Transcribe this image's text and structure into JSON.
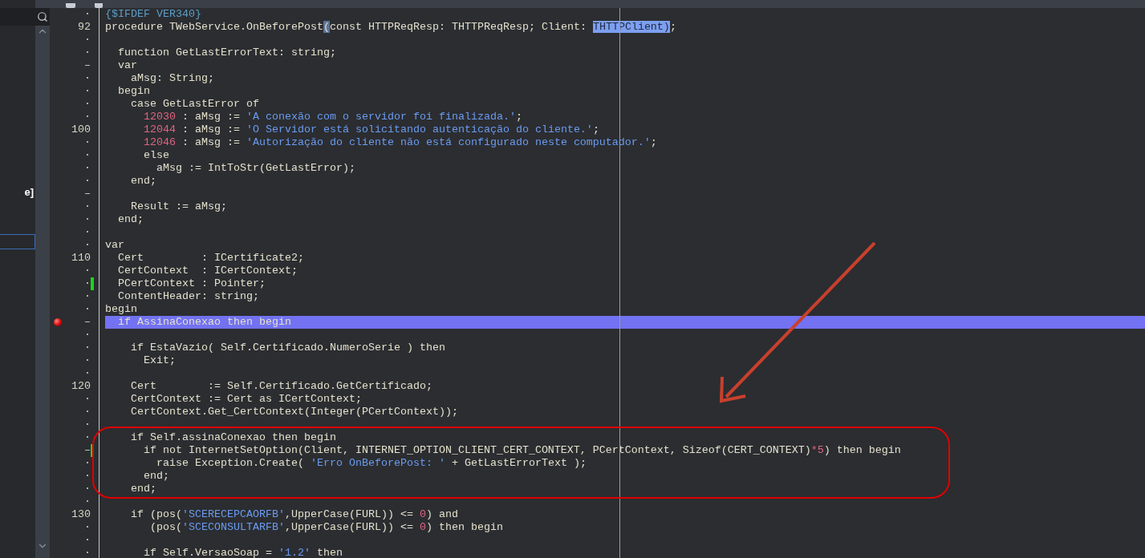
{
  "left_panel": {
    "visible_text": "e]"
  },
  "editor": {
    "lines": [
      {
        "gutter": "·",
        "breakpoint": false,
        "changed": false,
        "highlighted": false,
        "code": [
          {
            "kind": "dir",
            "text": "{$IFDEF VER340}"
          }
        ]
      },
      {
        "gutter": "92",
        "breakpoint": false,
        "changed": false,
        "highlighted": false,
        "code": [
          {
            "kind": "plain",
            "text": "procedure TWebService.OnBeforePost"
          },
          {
            "kind": "match",
            "text": "("
          },
          {
            "kind": "plain",
            "text": "const HTTPReqResp: THTTPReqResp; Client: "
          },
          {
            "kind": "sel",
            "text": "THTTPClient)"
          },
          {
            "kind": "plain",
            "text": ";"
          }
        ]
      },
      {
        "gutter": "·",
        "breakpoint": false,
        "changed": false,
        "highlighted": false
      },
      {
        "gutter": "·",
        "breakpoint": false,
        "changed": false,
        "highlighted": false,
        "code": [
          {
            "kind": "plain",
            "text": "  function GetLastErrorText: string;"
          }
        ]
      },
      {
        "gutter": "–",
        "breakpoint": false,
        "changed": false,
        "highlighted": false,
        "code": [
          {
            "kind": "plain",
            "text": "  var"
          }
        ]
      },
      {
        "gutter": "·",
        "breakpoint": false,
        "changed": false,
        "highlighted": false,
        "code": [
          {
            "kind": "plain",
            "text": "    aMsg: String;"
          }
        ]
      },
      {
        "gutter": "·",
        "breakpoint": false,
        "changed": false,
        "highlighted": false,
        "code": [
          {
            "kind": "plain",
            "text": "  begin"
          }
        ]
      },
      {
        "gutter": "·",
        "breakpoint": false,
        "changed": false,
        "highlighted": false,
        "code": [
          {
            "kind": "plain",
            "text": "    case GetLastError of"
          }
        ]
      },
      {
        "gutter": "·",
        "breakpoint": false,
        "changed": false,
        "highlighted": false,
        "code": [
          {
            "kind": "num",
            "text": "      12030"
          },
          {
            "kind": "plain",
            "text": " : aMsg := "
          },
          {
            "kind": "str",
            "text": "'A conexão com o servidor foi finalizada.'"
          },
          {
            "kind": "plain",
            "text": ";"
          }
        ]
      },
      {
        "gutter": "100",
        "breakpoint": false,
        "changed": false,
        "highlighted": false,
        "code": [
          {
            "kind": "num",
            "text": "      12044"
          },
          {
            "kind": "plain",
            "text": " : aMsg := "
          },
          {
            "kind": "str",
            "text": "'O Servidor está solicitando autenticação do cliente.'"
          },
          {
            "kind": "plain",
            "text": ";"
          }
        ]
      },
      {
        "gutter": "·",
        "breakpoint": false,
        "changed": false,
        "highlighted": false,
        "code": [
          {
            "kind": "num",
            "text": "      12046"
          },
          {
            "kind": "plain",
            "text": " : aMsg := "
          },
          {
            "kind": "str",
            "text": "'Autorização do cliente não está configurado neste computador.'"
          },
          {
            "kind": "plain",
            "text": ";"
          }
        ]
      },
      {
        "gutter": "·",
        "breakpoint": false,
        "changed": false,
        "highlighted": false,
        "code": [
          {
            "kind": "plain",
            "text": "      else"
          }
        ]
      },
      {
        "gutter": "·",
        "breakpoint": false,
        "changed": false,
        "highlighted": false,
        "code": [
          {
            "kind": "plain",
            "text": "        aMsg := IntToStr(GetLastError);"
          }
        ]
      },
      {
        "gutter": "·",
        "breakpoint": false,
        "changed": false,
        "highlighted": false,
        "code": [
          {
            "kind": "plain",
            "text": "    end;"
          }
        ]
      },
      {
        "gutter": "–",
        "breakpoint": false,
        "changed": false,
        "highlighted": false
      },
      {
        "gutter": "·",
        "breakpoint": false,
        "changed": false,
        "highlighted": false,
        "code": [
          {
            "kind": "plain",
            "text": "    Result := aMsg;"
          }
        ]
      },
      {
        "gutter": "·",
        "breakpoint": false,
        "changed": false,
        "highlighted": false,
        "code": [
          {
            "kind": "plain",
            "text": "  end;"
          }
        ]
      },
      {
        "gutter": "·",
        "breakpoint": false,
        "changed": false,
        "highlighted": false
      },
      {
        "gutter": "·",
        "breakpoint": false,
        "changed": false,
        "highlighted": false,
        "code": [
          {
            "kind": "plain",
            "text": "var"
          }
        ]
      },
      {
        "gutter": "110",
        "breakpoint": false,
        "changed": false,
        "highlighted": false,
        "code": [
          {
            "kind": "plain",
            "text": "  Cert         : ICertificate2;"
          }
        ]
      },
      {
        "gutter": "·",
        "breakpoint": false,
        "changed": false,
        "highlighted": false,
        "code": [
          {
            "kind": "plain",
            "text": "  CertContext  : ICertContext;"
          }
        ]
      },
      {
        "gutter": "·",
        "breakpoint": false,
        "changed": true,
        "highlighted": false,
        "code": [
          {
            "kind": "plain",
            "text": "  PCertContext : Pointer;"
          }
        ]
      },
      {
        "gutter": "·",
        "breakpoint": false,
        "changed": false,
        "highlighted": false,
        "code": [
          {
            "kind": "plain",
            "text": "  ContentHeader: string;"
          }
        ]
      },
      {
        "gutter": "·",
        "breakpoint": false,
        "changed": false,
        "highlighted": false,
        "code": [
          {
            "kind": "plain",
            "text": "begin"
          }
        ]
      },
      {
        "gutter": "–",
        "breakpoint": true,
        "changed": false,
        "highlighted": true,
        "code": [
          {
            "kind": "plain",
            "text": "  if AssinaConexao then begin"
          }
        ]
      },
      {
        "gutter": "·",
        "breakpoint": false,
        "changed": false,
        "highlighted": false
      },
      {
        "gutter": "·",
        "breakpoint": false,
        "changed": false,
        "highlighted": false,
        "code": [
          {
            "kind": "plain",
            "text": "    if EstaVazio( Self.Certificado.NumeroSerie ) then"
          }
        ]
      },
      {
        "gutter": "·",
        "breakpoint": false,
        "changed": false,
        "highlighted": false,
        "code": [
          {
            "kind": "plain",
            "text": "      Exit;"
          }
        ]
      },
      {
        "gutter": "·",
        "breakpoint": false,
        "changed": false,
        "highlighted": false
      },
      {
        "gutter": "120",
        "breakpoint": false,
        "changed": false,
        "highlighted": false,
        "code": [
          {
            "kind": "plain",
            "text": "    Cert        := Self.Certificado.GetCertificado;"
          }
        ]
      },
      {
        "gutter": "·",
        "breakpoint": false,
        "changed": false,
        "highlighted": false,
        "code": [
          {
            "kind": "plain",
            "text": "    CertContext := Cert as ICertContext;"
          }
        ]
      },
      {
        "gutter": "·",
        "breakpoint": false,
        "changed": false,
        "highlighted": false,
        "code": [
          {
            "kind": "plain",
            "text": "    CertContext.Get_CertContext(Integer(PCertContext));"
          }
        ]
      },
      {
        "gutter": "·",
        "breakpoint": false,
        "changed": false,
        "highlighted": false
      },
      {
        "gutter": "·",
        "breakpoint": false,
        "changed": false,
        "highlighted": false,
        "code": [
          {
            "kind": "plain",
            "text": "    if Self.assinaConexao then begin"
          }
        ]
      },
      {
        "gutter": "–",
        "breakpoint": false,
        "changed": true,
        "highlighted": false,
        "code": [
          {
            "kind": "plain",
            "text": "      if not InternetSetOption(Client, INTERNET_OPTION_CLIENT_CERT_CONTEXT, PCertContext, Sizeof(CERT_CONTEXT)"
          },
          {
            "kind": "num",
            "text": "*5"
          },
          {
            "kind": "plain",
            "text": ") then begin"
          }
        ]
      },
      {
        "gutter": "·",
        "breakpoint": false,
        "changed": false,
        "highlighted": false,
        "code": [
          {
            "kind": "plain",
            "text": "        raise Exception.Create( "
          },
          {
            "kind": "str",
            "text": "'Erro OnBeforePost: '"
          },
          {
            "kind": "plain",
            "text": " + GetLastErrorText );"
          }
        ]
      },
      {
        "gutter": "·",
        "breakpoint": false,
        "changed": false,
        "highlighted": false,
        "code": [
          {
            "kind": "plain",
            "text": "      end;"
          }
        ]
      },
      {
        "gutter": "·",
        "breakpoint": false,
        "changed": false,
        "highlighted": false,
        "code": [
          {
            "kind": "plain",
            "text": "    end;"
          }
        ]
      },
      {
        "gutter": "·",
        "breakpoint": false,
        "changed": false,
        "highlighted": false
      },
      {
        "gutter": "130",
        "breakpoint": false,
        "changed": false,
        "highlighted": false,
        "code": [
          {
            "kind": "plain",
            "text": "    if (pos("
          },
          {
            "kind": "str",
            "text": "'SCERECEPCAORFB'"
          },
          {
            "kind": "plain",
            "text": ",UpperCase(FURL)) <= "
          },
          {
            "kind": "num",
            "text": "0"
          },
          {
            "kind": "plain",
            "text": ") and"
          }
        ]
      },
      {
        "gutter": "·",
        "breakpoint": false,
        "changed": false,
        "highlighted": false,
        "code": [
          {
            "kind": "plain",
            "text": "       (pos("
          },
          {
            "kind": "str",
            "text": "'SCECONSULTARFB'"
          },
          {
            "kind": "plain",
            "text": ",UpperCase(FURL)) <= "
          },
          {
            "kind": "num",
            "text": "0"
          },
          {
            "kind": "plain",
            "text": ") then begin"
          }
        ]
      },
      {
        "gutter": "·",
        "breakpoint": false,
        "changed": false,
        "highlighted": false
      },
      {
        "gutter": "·",
        "breakpoint": false,
        "changed": false,
        "highlighted": false,
        "code": [
          {
            "kind": "plain",
            "text": "      if Self.VersaoSoap = "
          },
          {
            "kind": "str",
            "text": "'1.2'"
          },
          {
            "kind": "plain",
            "text": " then"
          }
        ]
      }
    ]
  }
}
